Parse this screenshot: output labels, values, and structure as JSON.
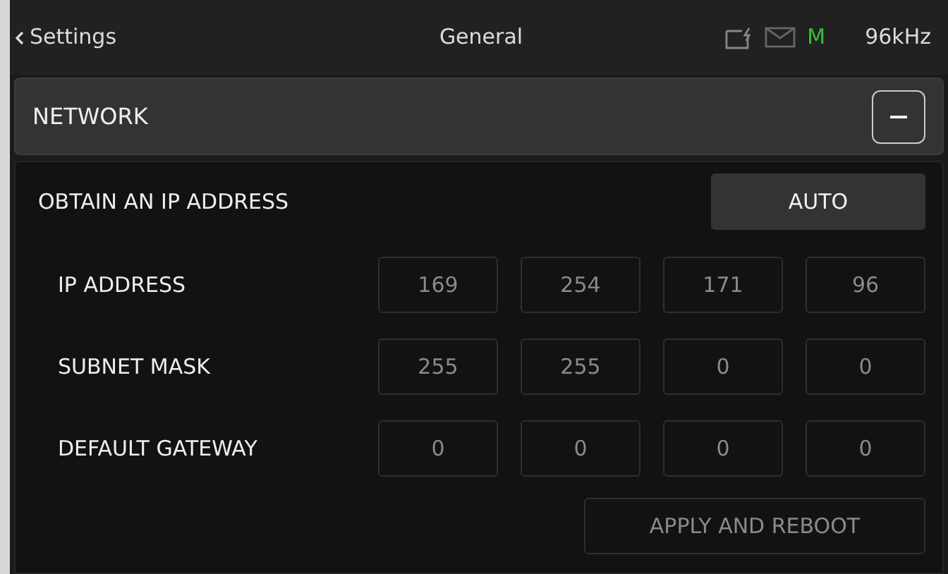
{
  "header": {
    "back": "Settings",
    "title": "General",
    "status_letter": "M",
    "sample_rate": "96kHz"
  },
  "network": {
    "title": "NETWORK",
    "expanded": true,
    "obtain": {
      "label": "OBTAIN AN IP ADDRESS",
      "value": "AUTO"
    },
    "rows": [
      {
        "label": "IP ADDRESS",
        "disabled": true,
        "octets": [
          "169",
          "254",
          "171",
          "96"
        ]
      },
      {
        "label": "SUBNET MASK",
        "disabled": true,
        "octets": [
          "255",
          "255",
          "0",
          "0"
        ]
      },
      {
        "label": "DEFAULT GATEWAY",
        "disabled": true,
        "octets": [
          "0",
          "0",
          "0",
          "0"
        ]
      }
    ],
    "apply_button": {
      "label": "APPLY AND REBOOT",
      "disabled": true
    }
  }
}
